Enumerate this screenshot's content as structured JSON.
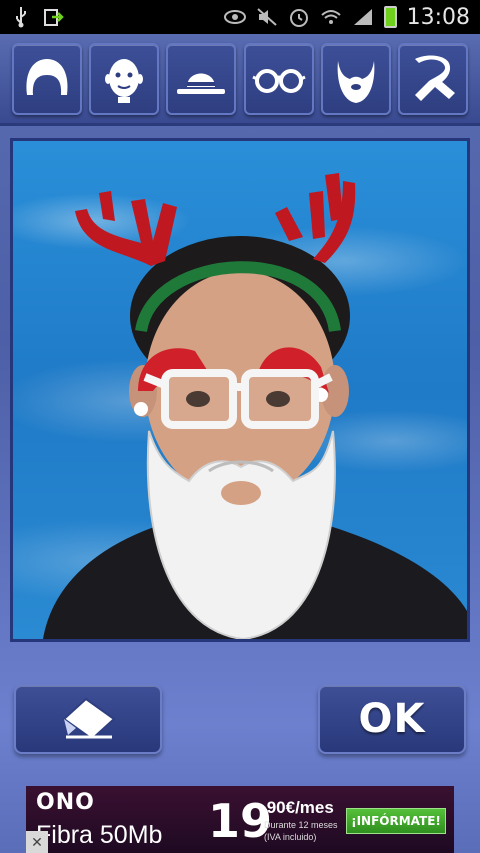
{
  "status_bar": {
    "time": "13:08",
    "left_icons": [
      "usb-icon",
      "download-icon"
    ],
    "right_icons": [
      "eye-icon",
      "mute-icon",
      "alarm-icon",
      "wifi-icon",
      "signal-icon",
      "battery-icon"
    ]
  },
  "toolbar": {
    "items": [
      {
        "name": "hair",
        "icon": "hair-icon"
      },
      {
        "name": "face",
        "icon": "face-icon"
      },
      {
        "name": "hat",
        "icon": "hat-icon"
      },
      {
        "name": "glasses",
        "icon": "glasses-icon"
      },
      {
        "name": "beard",
        "icon": "beard-icon"
      },
      {
        "name": "scarf",
        "icon": "scarf-icon"
      }
    ]
  },
  "controls": {
    "eraser_icon": "eraser-icon",
    "ok_label": "OK"
  },
  "ad": {
    "brand": "ONO",
    "product": "Fibra 50Mb",
    "price_big": "19",
    "price_small": ",90€/mes",
    "terms_line1": "Durante 12 meses",
    "terms_line2": "(IVA incluido)",
    "cta": "¡INFÓRMATE!",
    "close": "✕"
  },
  "colors": {
    "toolbar_bg": "#394a91",
    "button_bg": "#2e3e80",
    "button_border": "#6477c2",
    "sky_blue": "#1f7ac7",
    "ad_bg": "#3a1031",
    "cta_green": "#2f8f1f"
  }
}
